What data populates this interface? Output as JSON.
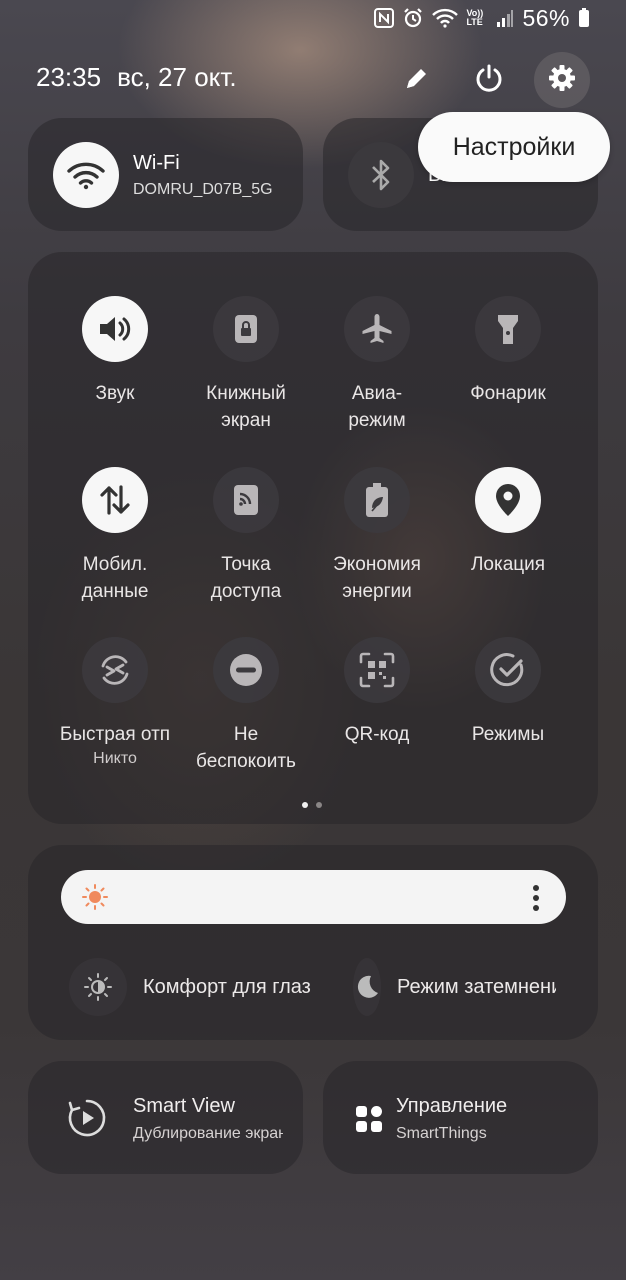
{
  "status_bar": {
    "battery": "56%",
    "volte": "Vo)) LTE",
    "icons": [
      "nfc-icon",
      "alarm-icon",
      "wifi-icon",
      "volte-icon",
      "signal-icon",
      "battery-icon"
    ]
  },
  "header": {
    "time": "23:35",
    "date": "вс, 27 окт.",
    "tooltip": "Настройки",
    "icons": [
      "edit-icon",
      "power-icon",
      "settings-icon"
    ]
  },
  "top_tiles": {
    "wifi": {
      "title": "Wi-Fi",
      "subtitle": "DOMRU_D07B_5G",
      "icon": "wifi-icon"
    },
    "bluetooth": {
      "title": "Bluetooth",
      "icon": "bluetooth-icon"
    }
  },
  "quick_grid": [
    {
      "label": "Звук",
      "sub": "",
      "icon": "sound-icon",
      "on": true
    },
    {
      "label": "Книжный\nэкран",
      "sub": "",
      "icon": "portrait-lock-icon",
      "on": false
    },
    {
      "label": "Авиа-\nрежим",
      "sub": "",
      "icon": "airplane-icon",
      "on": false
    },
    {
      "label": "Фонарик",
      "sub": "",
      "icon": "flashlight-icon",
      "on": false
    },
    {
      "label": "Мобил.\nданные",
      "sub": "",
      "icon": "mobile-data-icon",
      "on": true
    },
    {
      "label": "Точка\nдоступа",
      "sub": "",
      "icon": "hotspot-icon",
      "on": false
    },
    {
      "label": "Экономия\nэнергии",
      "sub": "",
      "icon": "power-saving-icon",
      "on": false
    },
    {
      "label": "Локация",
      "sub": "",
      "icon": "location-icon",
      "on": true
    },
    {
      "label": "Быстрая отп",
      "sub": "Никто",
      "icon": "quick-share-icon",
      "on": false
    },
    {
      "label": "Не\nбеспокоить",
      "sub": "",
      "icon": "do-not-disturb-icon",
      "on": false
    },
    {
      "label": "QR-код",
      "sub": "",
      "icon": "qr-code-icon",
      "on": false
    },
    {
      "label": "Режимы",
      "sub": "",
      "icon": "modes-icon",
      "on": false
    }
  ],
  "pager": {
    "pages": 2,
    "active": 1
  },
  "brightness": {
    "level": 0.0,
    "icon": "sun-icon",
    "more_icon": "more-vert-icon"
  },
  "display_options": [
    {
      "label": "Комфорт для глаз",
      "icon": "eye-comfort-icon"
    },
    {
      "label": "Режим затемнения",
      "icon": "dark-mode-icon"
    }
  ],
  "bottom_tiles": {
    "smart_view": {
      "title": "Smart View",
      "subtitle": "Дублирование экрана",
      "icon": "smart-view-icon"
    },
    "smartthings": {
      "title": "Управление",
      "subtitle": "SmartThings",
      "icon": "smartthings-icon"
    }
  },
  "colors": {
    "tile_on": "#f7f7f7",
    "tile_off": "#3c3a3e",
    "brightness_sun": "#f08a5d"
  }
}
